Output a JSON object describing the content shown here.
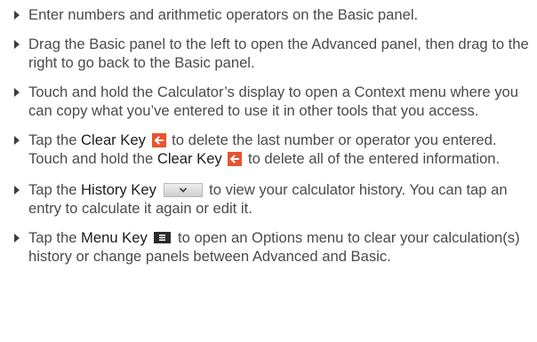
{
  "bullets": [
    {
      "text": "Enter numbers and arithmetic operators on the Basic panel."
    },
    {
      "text": "Drag the Basic panel to the left to open the Advanced panel, then drag to the right to go back to the Basic panel."
    },
    {
      "text": "Touch and hold the Calculator’s display to open a Context menu where you can copy what you’ve entered to use it in other tools that you access."
    },
    {
      "before": "Tap the ",
      "key1": "Clear Key",
      "middle": " to delete the last number or operator you entered. Touch and hold the ",
      "key2": "Clear Key",
      "after": " to delete all of the entered information."
    },
    {
      "before": "Tap the ",
      "key": "History Key",
      "after": " to view your calculator history. You can tap an entry to calculate it again or edit it."
    },
    {
      "before": "Tap the ",
      "key": "Menu Key",
      "after": " to open an Options menu to clear your calculation(s) history or change panels between Advanced and Basic."
    }
  ],
  "icons": {
    "clear_key": "clear-key-icon",
    "history_key": "history-key-icon",
    "menu_key": "menu-key-icon",
    "bullet": "triangle-bullet-icon"
  },
  "colors": {
    "text": "#4a4a4a",
    "key_text": "#1c1c1c",
    "clear_key_bg": "#e8532f",
    "menu_key_bg": "#2b2b2b"
  }
}
